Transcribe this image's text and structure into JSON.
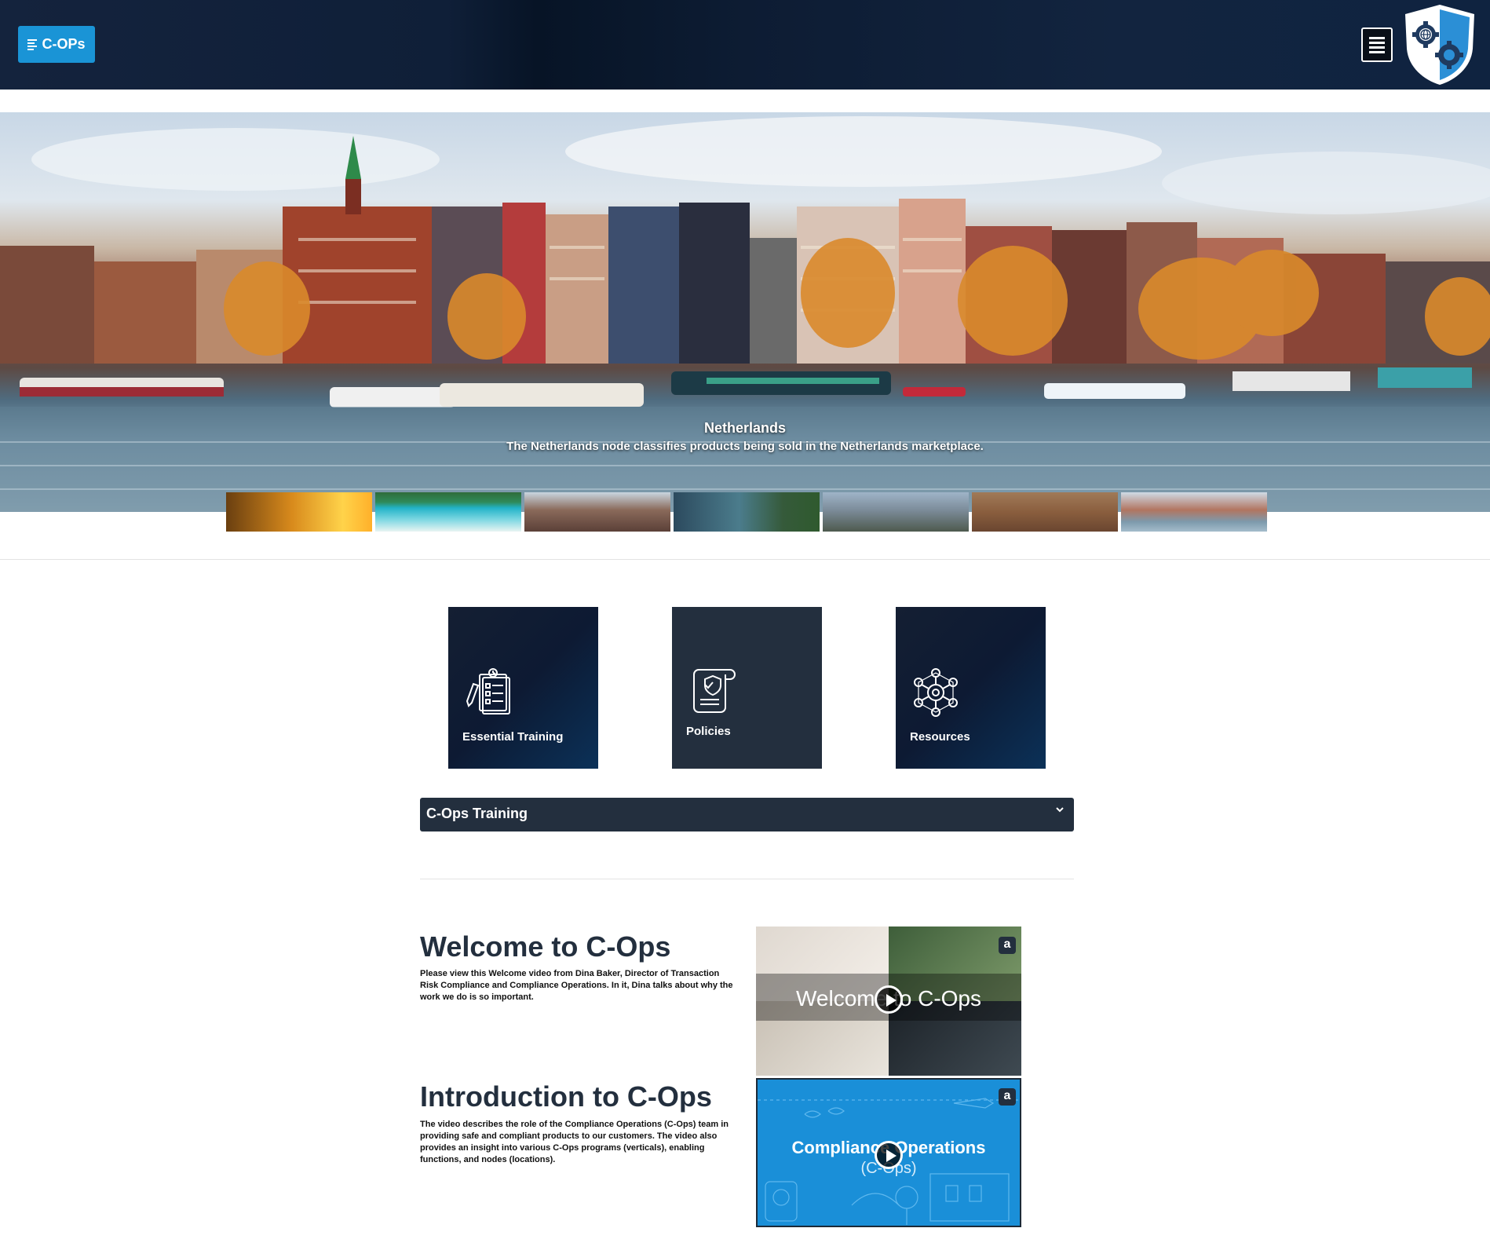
{
  "header": {
    "brand_label": "C-OPs",
    "menu_icon": "hamburger-menu-icon",
    "logo_icon": "shield-gear-globe-logo"
  },
  "hero": {
    "title": "Netherlands",
    "description": "The Netherlands node classifies products being sold in the Netherlands marketplace."
  },
  "thumbnails": [
    {
      "name": "taj-mahal-sunset"
    },
    {
      "name": "tropical-beach"
    },
    {
      "name": "european-old-town"
    },
    {
      "name": "river-gorge"
    },
    {
      "name": "great-wall"
    },
    {
      "name": "desert-cliffs"
    },
    {
      "name": "netherlands-canal"
    }
  ],
  "tiles": [
    {
      "label": "Essential Training",
      "icon": "clipboard-checklist-icon"
    },
    {
      "label": "Policies",
      "icon": "policy-scroll-shield-icon"
    },
    {
      "label": "Resources",
      "icon": "network-gear-icon"
    }
  ],
  "accordion": {
    "label": "C-Ops Training",
    "icon": "chevron-down-icon"
  },
  "videos": [
    {
      "title": "Welcome to C-Ops",
      "description": "Please view this Welcome video from Dina Baker, Director of Transaction Risk Compliance and Compliance Operations. In it, Dina talks about why the work we do is so important.",
      "thumbnail_text": "Welcome to C-Ops"
    },
    {
      "title": "Introduction to C-Ops",
      "description": "The video describes the role of the Compliance Operations (C-Ops) team in providing safe and compliant products to our customers. The video also provides an insight into various C-Ops programs (verticals), enabling functions, and nodes (locations).",
      "thumbnail_text": "Compliance Operations",
      "thumbnail_subtext": "(C-Ops)"
    }
  ],
  "colors": {
    "header_bg": "#0f1f38",
    "brand_button": "#1a94d6",
    "tile_bg": "#232f3e",
    "accordion_bg": "#232f3e",
    "title_text": "#232f3e",
    "video2_bg": "#1a8fd8"
  }
}
